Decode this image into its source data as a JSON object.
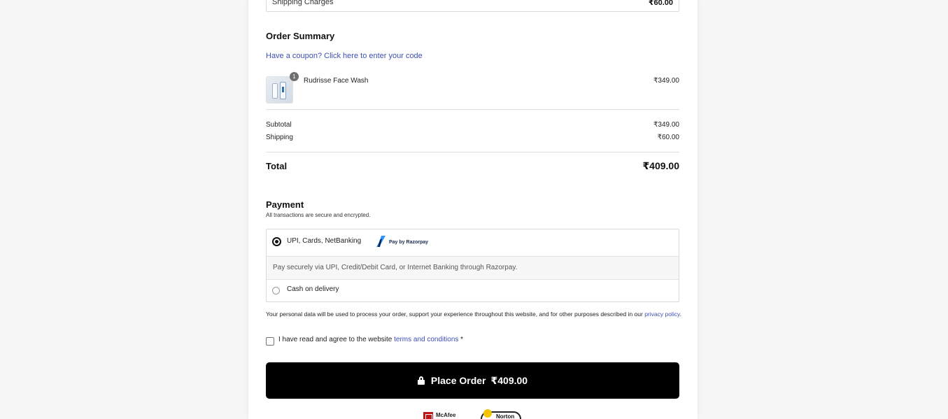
{
  "shipping_summary": {
    "label": "Shipping Charges",
    "value": "₹60.00"
  },
  "order_summary": {
    "heading": "Order Summary",
    "coupon_link": "Have a coupon? Click here to enter your code",
    "items": [
      {
        "name": "Rudrisse Face Wash",
        "quantity": "1",
        "price": "₹349.00"
      }
    ],
    "subtotal_label": "Subtotal",
    "subtotal_value": "₹349.00",
    "shipping_label": "Shipping",
    "shipping_value": "₹60.00",
    "total_label": "Total",
    "total_value": "₹409.00"
  },
  "payment": {
    "heading": "Payment",
    "subtitle": "All transactions are secure and encrypted.",
    "options": [
      {
        "label": "UPI, Cards, NetBanking",
        "selected": true,
        "badge": "Pay by Razorpay",
        "description": "Pay securely via UPI, Credit/Debit Card, or Internet Banking through Razorpay."
      },
      {
        "label": "Cash on delivery",
        "selected": false
      }
    ]
  },
  "privacy": {
    "text_before": "Your personal data will be used to process your order, support your experience throughout this website, and for other purposes described in our ",
    "link": "privacy policy",
    "text_after": "."
  },
  "terms": {
    "text": "I have read and agree to the website ",
    "link": "terms and conditions",
    "required_mark": " *",
    "checked": false
  },
  "place_order": {
    "label": "Place Order",
    "amount": "₹409.00"
  },
  "trust_badges": [
    {
      "name": "McAfee",
      "label": "McAfee"
    },
    {
      "name": "Norton",
      "label": "Norton"
    }
  ],
  "colors": {
    "link": "#3e4fb5",
    "button_bg": "#000000",
    "button_text": "#ffffff",
    "page_bg": "#f6f6f6"
  }
}
